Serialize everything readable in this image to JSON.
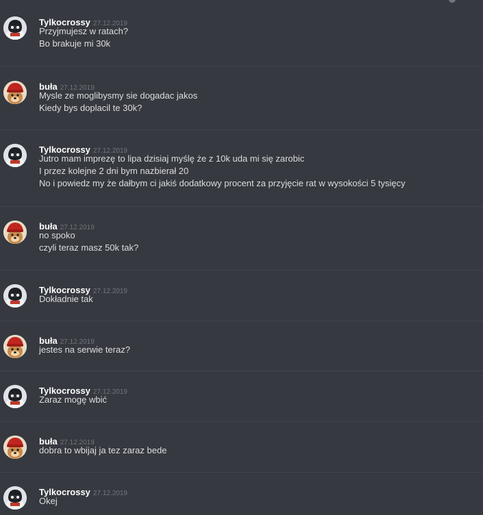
{
  "users": {
    "a": "Tylkocrossy",
    "b": "buła"
  },
  "messages": [
    {
      "author": "Tylkocrossy",
      "date": "27.12.2019",
      "avatar": "robot-avatar-icon",
      "lines": [
        "Przyjmujesz w ratach?",
        "Bo brakuje mi 30k"
      ]
    },
    {
      "author": "buła",
      "date": "27.12.2019",
      "avatar": "dog-red-hat-avatar-icon",
      "lines": [
        "Mysle ze moglibysmy sie dogadac jakos",
        "Kiedy bys doplacil te 30k?"
      ]
    },
    {
      "author": "Tylkocrossy",
      "date": "27.12.2019",
      "avatar": "robot-avatar-icon",
      "lines": [
        "Jutro mam imprezę to lipa dzisiaj myślę że z 10k uda mi się zarobic",
        "I przez kolejne 2 dni bym nazbierał 20",
        "No i powiedz my że dałbym ci jakiś dodatkowy procent za przyjęcie rat w wysokości 5 tysięcy"
      ]
    },
    {
      "author": "buła",
      "date": "27.12.2019",
      "avatar": "dog-red-hat-avatar-icon",
      "lines": [
        "no spoko",
        "czyli teraz masz 50k tak?"
      ]
    },
    {
      "author": "Tylkocrossy",
      "date": "27.12.2019",
      "avatar": "robot-avatar-icon",
      "lines": [
        "Dokładnie tak"
      ]
    },
    {
      "author": "buła",
      "date": "27.12.2019",
      "avatar": "dog-red-hat-avatar-icon",
      "lines": [
        "jestes na serwie teraz?"
      ]
    },
    {
      "author": "Tylkocrossy",
      "date": "27.12.2019",
      "avatar": "robot-avatar-icon",
      "lines": [
        "Zaraz mogę wbić"
      ]
    },
    {
      "author": "buła",
      "date": "27.12.2019",
      "avatar": "dog-red-hat-avatar-icon",
      "lines": [
        "dobra to wbijaj ja tez zaraz bede"
      ]
    },
    {
      "author": "Tylkocrossy",
      "date": "27.12.2019",
      "avatar": "robot-avatar-icon",
      "lines": [
        "Okej"
      ]
    }
  ],
  "colors": {
    "background": "#36393f",
    "author": "#ffffff",
    "timestamp": "#72767d",
    "text": "#dcddde",
    "divider": "#40434a"
  }
}
